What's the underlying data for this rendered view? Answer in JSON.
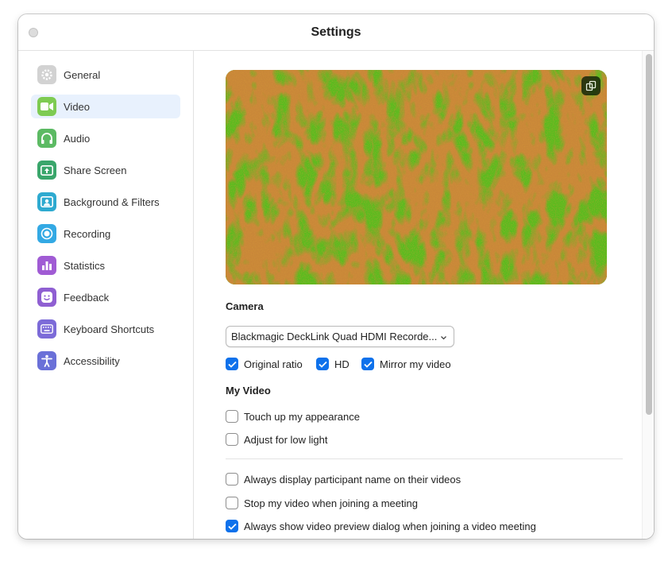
{
  "window": {
    "title": "Settings"
  },
  "sidebar": {
    "items": [
      {
        "label": "General",
        "icon": "gear-icon",
        "color": "#cfcfcf",
        "active": false
      },
      {
        "label": "Video",
        "icon": "video-camera-icon",
        "color": "#6cc24a",
        "active": true
      },
      {
        "label": "Audio",
        "icon": "headphones-icon",
        "color": "#5cb85c",
        "active": false
      },
      {
        "label": "Share Screen",
        "icon": "share-screen-icon",
        "color": "#3ca26b",
        "active": false
      },
      {
        "label": "Background & Filters",
        "icon": "background-person-icon",
        "color": "#2ea6c5",
        "active": false
      },
      {
        "label": "Recording",
        "icon": "record-icon",
        "color": "#33a8e0",
        "active": false
      },
      {
        "label": "Statistics",
        "icon": "bar-chart-icon",
        "color": "#9b59d0",
        "active": false
      },
      {
        "label": "Feedback",
        "icon": "smiley-icon",
        "color": "#8e5ccf",
        "active": false
      },
      {
        "label": "Keyboard Shortcuts",
        "icon": "keyboard-icon",
        "color": "#7b6ad6",
        "active": false
      },
      {
        "label": "Accessibility",
        "icon": "accessibility-icon",
        "color": "#6b6fd6",
        "active": false
      }
    ]
  },
  "video": {
    "camera_heading": "Camera",
    "camera_selected": "Blackmagic DeckLink Quad HDMI Recorde...",
    "options": [
      {
        "label": "Original ratio",
        "checked": true
      },
      {
        "label": "HD",
        "checked": true
      },
      {
        "label": "Mirror my video",
        "checked": true
      }
    ],
    "my_video_heading": "My Video",
    "my_video_options": [
      {
        "label": "Touch up my appearance",
        "checked": false
      },
      {
        "label": "Adjust for low light",
        "checked": false
      }
    ],
    "more_options": [
      {
        "label": "Always display participant name on their videos",
        "checked": false
      },
      {
        "label": "Stop my video when joining a meeting",
        "checked": false
      },
      {
        "label": "Always show video preview dialog when joining a video meeting",
        "checked": true
      }
    ]
  },
  "colors": {
    "accent": "#0e71eb",
    "active_nav_bg": "#e8f1fd"
  }
}
